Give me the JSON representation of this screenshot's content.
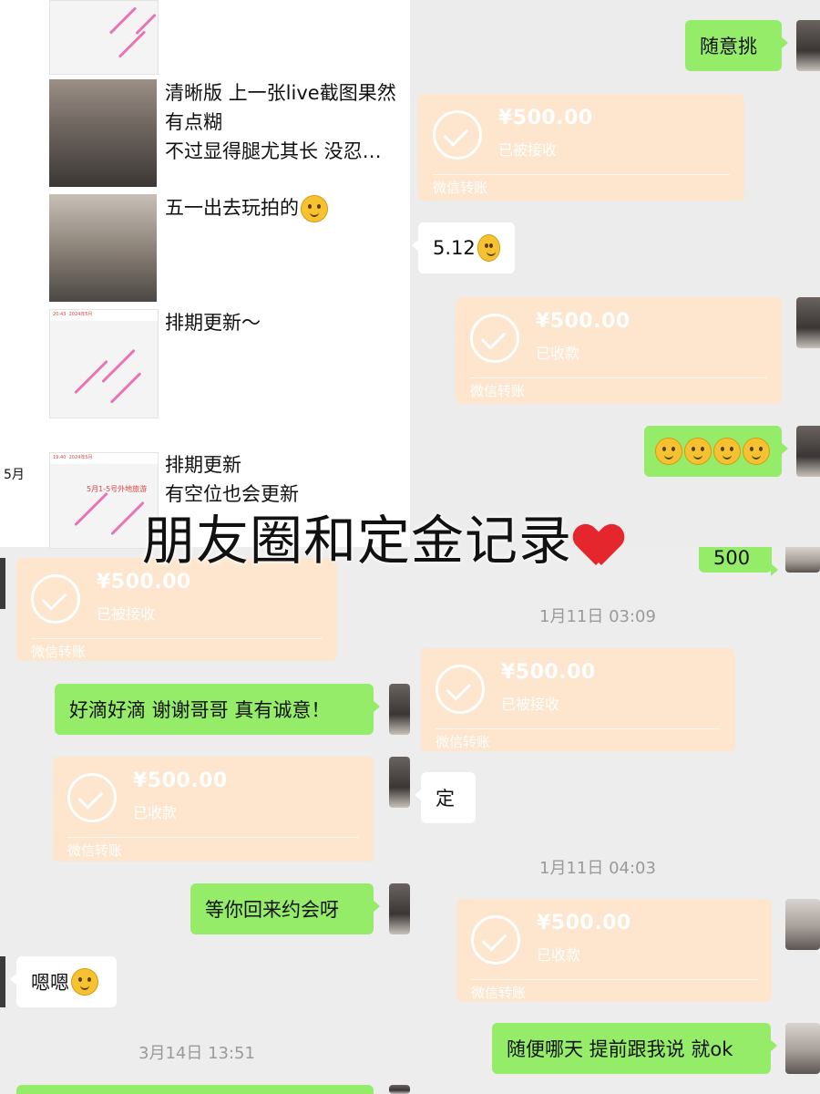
{
  "overlay": {
    "title": "朋友圈和定金记录",
    "heart_icon": "heart-icon",
    "heart_color": "#e5262d"
  },
  "moments": {
    "side_date": "5月",
    "posts": [
      {
        "text": "清晰版 上一张live截图果然有点糊",
        "text2": "不过显得腿尤其长 没忍…"
      },
      {
        "text": "五一出去玩拍的"
      },
      {
        "text": "排期更新～"
      },
      {
        "text": "排期更新",
        "text2": "有空位也会更新"
      }
    ],
    "calendar_title": "2024年5月",
    "calendar_time": "20:43",
    "calendar_time2": "19:40",
    "calendar_note": "5月1-5号外地旅游"
  },
  "chat_top": {
    "msg_random": "随意挑",
    "transfer1": {
      "amount": "¥500.00",
      "status": "已被接收",
      "footer": "微信转账"
    },
    "msg_date": "5.12",
    "transfer2": {
      "amount": "¥500.00",
      "status": "已收款",
      "footer": "微信转账"
    },
    "partial_bubble": "500"
  },
  "chat_left": {
    "transfer": {
      "amount": "¥500.00",
      "status": "已被接收",
      "footer": "微信转账"
    },
    "msg_thanks": "好滴好滴 谢谢哥哥 真有诚意！",
    "transfer_recv": {
      "amount": "¥500.00",
      "status": "已收款",
      "footer": "微信转账"
    },
    "msg_date_wait": "等你回来约会呀",
    "msg_ok": "嗯嗯",
    "timestamp": "3月14日 13:51"
  },
  "chat_right": {
    "timestamp1": "1月11日 03:09",
    "transfer1": {
      "amount": "¥500.00",
      "status": "已被接收",
      "footer": "微信转账"
    },
    "msg_ding": "定",
    "timestamp2": "1月11日 04:03",
    "transfer2": {
      "amount": "¥500.00",
      "status": "已收款",
      "footer": "微信转账"
    },
    "msg_anyday": "随便哪天 提前跟我说 就ok"
  },
  "colors": {
    "green_bubble": "#95ec69",
    "transfer_bg": "#fde6cd",
    "background": "#ededed"
  }
}
